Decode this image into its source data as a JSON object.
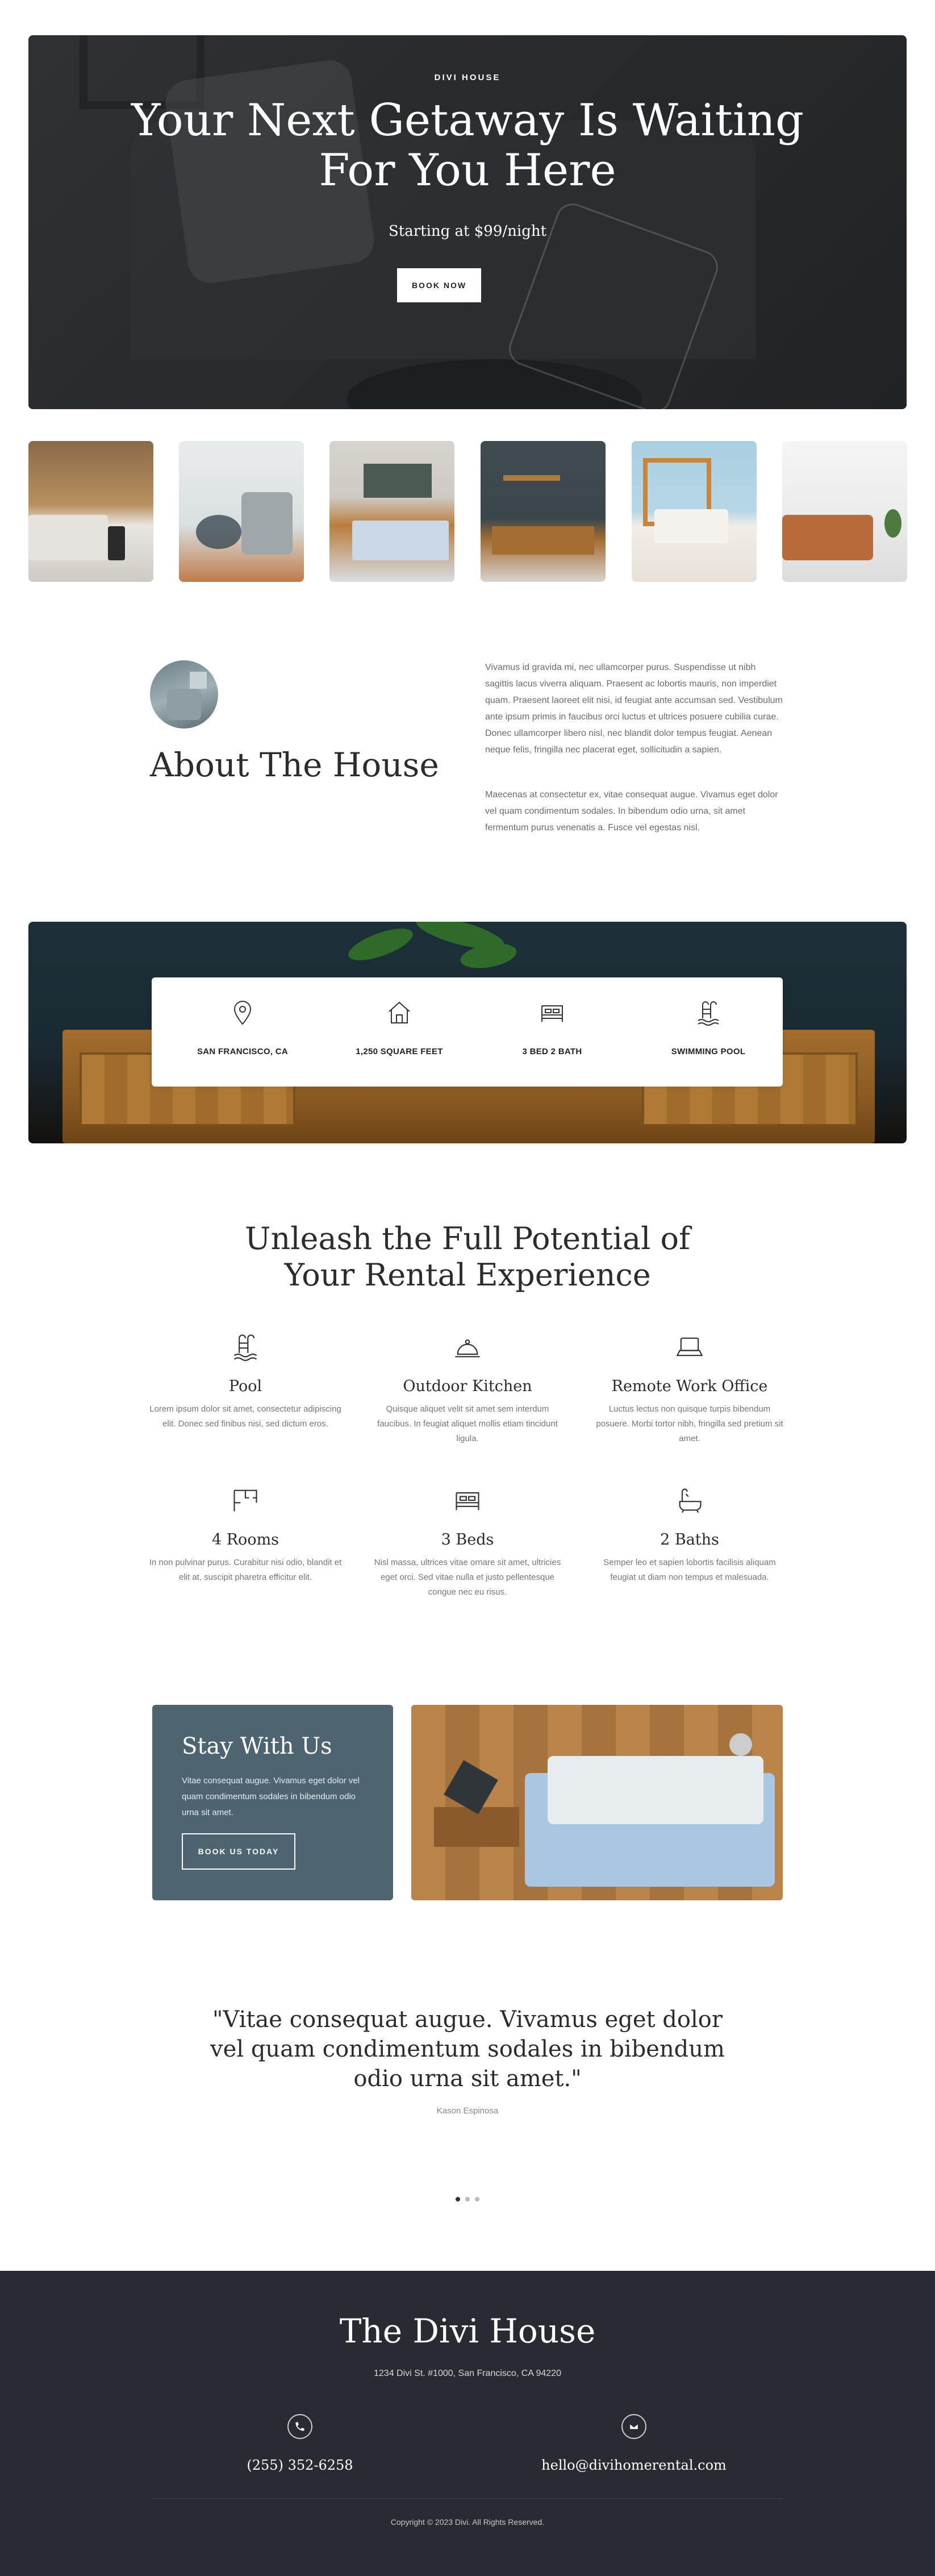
{
  "hero": {
    "eyebrow": "DIVI HOUSE",
    "title_line1": "Your Next Getaway Is Waiting",
    "title_line2": "For You Here",
    "subtitle": "Starting at $99/night",
    "button_label": "BOOK NOW"
  },
  "gallery": {
    "items": [
      "bedroom-lamp",
      "armchair-corner",
      "bed-with-painting",
      "tv-console",
      "bathroom-sink",
      "sofa-window"
    ]
  },
  "about": {
    "title": "About The House",
    "paragraph1": "Vivamus id gravida mi, nec ullamcorper purus. Suspendisse ut nibh sagittis lacus viverra aliquam. Praesent ac lobortis mauris, non imperdiet quam. Praesent laoreet elit nisi, id feugiat ante accumsan sed. Vestibulum ante ipsum primis in faucibus orci luctus et ultrices posuere cubilia curae. Donec ullamcorper libero nisl, nec blandit dolor tempus feugiat. Aenean neque felis, fringilla nec placerat eget, sollicitudin a sapien.",
    "paragraph2": "Maecenas at consectetur ex, vitae consequat augue. Vivamus eget dolor vel quam condimentum sodales. In bibendum odio urna, sit amet fermentum purus venenatis a. Fusce vel egestas nisl."
  },
  "stats": [
    {
      "icon": "map-pin-icon",
      "label": "SAN FRANCISCO, CA"
    },
    {
      "icon": "house-icon",
      "label": "1,250 SQUARE FEET"
    },
    {
      "icon": "bed-icon",
      "label": "3 BED 2 BATH"
    },
    {
      "icon": "pool-ladder-icon",
      "label": "SWIMMING POOL"
    }
  ],
  "features": {
    "title_line1": "Unleash the Full Potential of",
    "title_line2": "Your Rental Experience",
    "items": [
      {
        "icon": "pool-ladder-icon",
        "name": "Pool",
        "desc": "Lorem ipsum dolor sit amet, consectetur adipiscing elit. Donec sed finibus nisi, sed dictum eros."
      },
      {
        "icon": "cloche-icon",
        "name": "Outdoor Kitchen",
        "desc": "Quisque aliquet velit sit amet sem interdum faucibus. In feugiat aliquet mollis etiam tincidunt ligula."
      },
      {
        "icon": "laptop-icon",
        "name": "Remote Work Office",
        "desc": "Luctus lectus non quisque turpis bibendum posuere. Morbi tortor nibh, fringilla sed pretium sit amet."
      },
      {
        "icon": "floor-plan-icon",
        "name": "4 Rooms",
        "desc": "In non pulvinar purus. Curabitur nisi odio, blandit et elit at, suscipit pharetra efficitur elit."
      },
      {
        "icon": "bed-icon",
        "name": "3 Beds",
        "desc": "Nisl massa, ultrices vitae ornare sit amet, ultricies eget orci. Sed vitae nulla et justo pellentesque congue nec eu risus."
      },
      {
        "icon": "bathtub-icon",
        "name": "2 Baths",
        "desc": "Semper leo et sapien lobortis facilisis aliquam feugiat ut diam non tempus et malesuada."
      }
    ]
  },
  "stay": {
    "title": "Stay With Us",
    "text": "Vitae consequat augue. Vivamus eget dolor vel quam condimentum sodales in bibendum odio urna sit amet.",
    "button_label": "BOOK US TODAY"
  },
  "testimonial": {
    "line1": "\"Vitae consequat augue. Vivamus eget dolor",
    "line2": "vel quam condimentum sodales in bibendum",
    "line3": "odio urna sit amet.\"",
    "author": "Kason Espinosa"
  },
  "footer": {
    "title": "The Divi House",
    "address": "1234 Divi St. #1000, San Francisco, CA 94220",
    "phone": "(255) 352-6258",
    "email": "hello@divihomerental.com",
    "copyright": "Copyright © 2023 Divi. All Rights Reserved."
  },
  "colors": {
    "accent_slate": "#4e6571",
    "footer_bg": "#292b33",
    "hero_dark": "#2f3133"
  }
}
